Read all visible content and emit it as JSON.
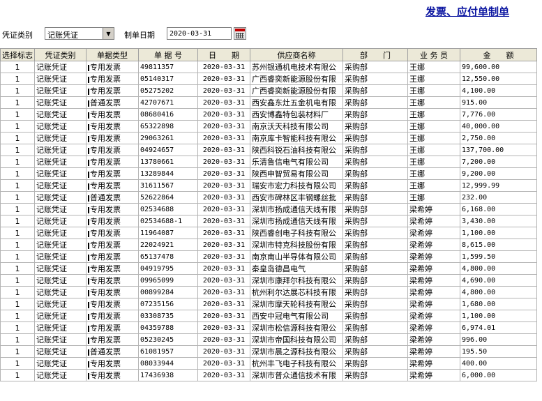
{
  "header": {
    "title": "发票、应付单制单",
    "voucher_type_label": "凭证类别",
    "voucher_type_value": "记账凭证",
    "date_label": "制单日期",
    "date_value": "2020-03-31"
  },
  "table": {
    "columns": [
      "选择标志",
      "凭证类别",
      "单据类型",
      "单 据 号",
      "日　　期",
      "供应商名称",
      "部　　门",
      "业 务 员",
      "金　　额"
    ],
    "rows": [
      {
        "flag": "1",
        "vtype": "记账凭证",
        "dtype": "专用发票",
        "no": "49811357",
        "date": "2020-03-31",
        "supplier": "苏州银通机电技术有限公",
        "dept": "采购部",
        "person": "王娜",
        "amount": "99,600.00"
      },
      {
        "flag": "1",
        "vtype": "记账凭证",
        "dtype": "专用发票",
        "no": "05140317",
        "date": "2020-03-31",
        "supplier": "广西睿奕新能源股份有限",
        "dept": "采购部",
        "person": "王娜",
        "amount": "12,550.00"
      },
      {
        "flag": "1",
        "vtype": "记账凭证",
        "dtype": "专用发票",
        "no": "05275202",
        "date": "2020-03-31",
        "supplier": "广西睿奕新能源股份有限",
        "dept": "采购部",
        "person": "王娜",
        "amount": "4,100.00"
      },
      {
        "flag": "1",
        "vtype": "记账凭证",
        "dtype": "普通发票",
        "no": "42707671",
        "date": "2020-03-31",
        "supplier": "西安鑫东灶五金机电有限",
        "dept": "采购部",
        "person": "王娜",
        "amount": "915.00"
      },
      {
        "flag": "1",
        "vtype": "记账凭证",
        "dtype": "专用发票",
        "no": "08680416",
        "date": "2020-03-31",
        "supplier": "西安博鑫特包装材料厂",
        "dept": "采购部",
        "person": "王娜",
        "amount": "7,776.00"
      },
      {
        "flag": "1",
        "vtype": "记账凭证",
        "dtype": "专用发票",
        "no": "65322898",
        "date": "2020-03-31",
        "supplier": "南京沃天科技有限公司",
        "dept": "采购部",
        "person": "王娜",
        "amount": "40,000.00"
      },
      {
        "flag": "1",
        "vtype": "记账凭证",
        "dtype": "专用发票",
        "no": "29063261",
        "date": "2020-03-31",
        "supplier": "南京库卡智能科技有限公",
        "dept": "采购部",
        "person": "王娜",
        "amount": "2,750.00"
      },
      {
        "flag": "1",
        "vtype": "记账凭证",
        "dtype": "专用发票",
        "no": "04924657",
        "date": "2020-03-31",
        "supplier": "陕西科锐石油科技有限公",
        "dept": "采购部",
        "person": "王娜",
        "amount": "137,700.00"
      },
      {
        "flag": "1",
        "vtype": "记账凭证",
        "dtype": "专用发票",
        "no": "13780661",
        "date": "2020-03-31",
        "supplier": "乐清鲁信电气有限公司",
        "dept": "采购部",
        "person": "王娜",
        "amount": "7,200.00"
      },
      {
        "flag": "1",
        "vtype": "记账凭证",
        "dtype": "专用发票",
        "no": "13289844",
        "date": "2020-03-31",
        "supplier": "陕西申智贸易有限公司",
        "dept": "采购部",
        "person": "王娜",
        "amount": "9,200.00"
      },
      {
        "flag": "1",
        "vtype": "记账凭证",
        "dtype": "专用发票",
        "no": "31611567",
        "date": "2020-03-31",
        "supplier": "瑞安市宏力科技有限公司",
        "dept": "采购部",
        "person": "王娜",
        "amount": "12,999.99"
      },
      {
        "flag": "1",
        "vtype": "记账凭证",
        "dtype": "普通发票",
        "no": "52622864",
        "date": "2020-03-31",
        "supplier": "西安市碑林区丰钢螺丝批",
        "dept": "采购部",
        "person": "王娜",
        "amount": "232.00"
      },
      {
        "flag": "1",
        "vtype": "记账凭证",
        "dtype": "专用发票",
        "no": "02534688",
        "date": "2020-03-31",
        "supplier": "深圳市扬成通信天线有限",
        "dept": "采购部",
        "person": "梁希婷",
        "amount": "6,168.00"
      },
      {
        "flag": "1",
        "vtype": "记账凭证",
        "dtype": "专用发票",
        "no": "02534688-1",
        "date": "2020-03-31",
        "supplier": "深圳市扬成通信天线有限",
        "dept": "采购部",
        "person": "梁希婷",
        "amount": "3,430.00"
      },
      {
        "flag": "1",
        "vtype": "记账凭证",
        "dtype": "专用发票",
        "no": "11964087",
        "date": "2020-03-31",
        "supplier": "陕西睿创电子科技有限公",
        "dept": "采购部",
        "person": "梁希婷",
        "amount": "1,100.00"
      },
      {
        "flag": "1",
        "vtype": "记账凭证",
        "dtype": "专用发票",
        "no": "22024921",
        "date": "2020-03-31",
        "supplier": "深圳市特克科技股份有限",
        "dept": "采购部",
        "person": "梁希婷",
        "amount": "8,615.00"
      },
      {
        "flag": "1",
        "vtype": "记账凭证",
        "dtype": "专用发票",
        "no": "65137478",
        "date": "2020-03-31",
        "supplier": "南京南山半导体有限公司",
        "dept": "采购部",
        "person": "梁希婷",
        "amount": "1,599.50"
      },
      {
        "flag": "1",
        "vtype": "记账凭证",
        "dtype": "专用发票",
        "no": "04919795",
        "date": "2020-03-31",
        "supplier": "秦皇岛德昌电气",
        "dept": "采购部",
        "person": "梁希婷",
        "amount": "4,800.00"
      },
      {
        "flag": "1",
        "vtype": "记账凭证",
        "dtype": "专用发票",
        "no": "09965099",
        "date": "2020-03-31",
        "supplier": "深圳市康拜尔科技有限公",
        "dept": "采购部",
        "person": "梁希婷",
        "amount": "4,690.00"
      },
      {
        "flag": "1",
        "vtype": "记账凭证",
        "dtype": "专用发票",
        "no": "00899284",
        "date": "2020-03-31",
        "supplier": "杭州利尔达展芯科技有限",
        "dept": "采购部",
        "person": "梁希婷",
        "amount": "4,800.00"
      },
      {
        "flag": "1",
        "vtype": "记账凭证",
        "dtype": "专用发票",
        "no": "07235156",
        "date": "2020-03-31",
        "supplier": "深圳市摩天轮科技有限公",
        "dept": "采购部",
        "person": "梁希婷",
        "amount": "1,680.00"
      },
      {
        "flag": "1",
        "vtype": "记账凭证",
        "dtype": "专用发票",
        "no": "03308735",
        "date": "2020-03-31",
        "supplier": "西安中冠电气有限公司",
        "dept": "采购部",
        "person": "梁希婷",
        "amount": "1,100.00"
      },
      {
        "flag": "1",
        "vtype": "记账凭证",
        "dtype": "专用发票",
        "no": "04359788",
        "date": "2020-03-31",
        "supplier": "深圳市松信源科技有限公",
        "dept": "采购部",
        "person": "梁希婷",
        "amount": "6,974.01"
      },
      {
        "flag": "1",
        "vtype": "记账凭证",
        "dtype": "专用发票",
        "no": "05230245",
        "date": "2020-03-31",
        "supplier": "深圳市帝国科技有限公司",
        "dept": "采购部",
        "person": "梁希婷",
        "amount": "996.00"
      },
      {
        "flag": "1",
        "vtype": "记账凭证",
        "dtype": "普通发票",
        "no": "61081957",
        "date": "2020-03-31",
        "supplier": "深圳市晨之源科技有限公",
        "dept": "采购部",
        "person": "梁希婷",
        "amount": "195.50"
      },
      {
        "flag": "1",
        "vtype": "记账凭证",
        "dtype": "专用发票",
        "no": "08033944",
        "date": "2020-03-31",
        "supplier": "杭州丰飞电子科技有限公",
        "dept": "采购部",
        "person": "梁希婷",
        "amount": "400.00"
      },
      {
        "flag": "1",
        "vtype": "记账凭证",
        "dtype": "专用发票",
        "no": "17436938",
        "date": "2020-03-31",
        "supplier": "深圳市普众通信技术有限",
        "dept": "采购部",
        "person": "梁希婷",
        "amount": "6,000.00"
      }
    ]
  }
}
